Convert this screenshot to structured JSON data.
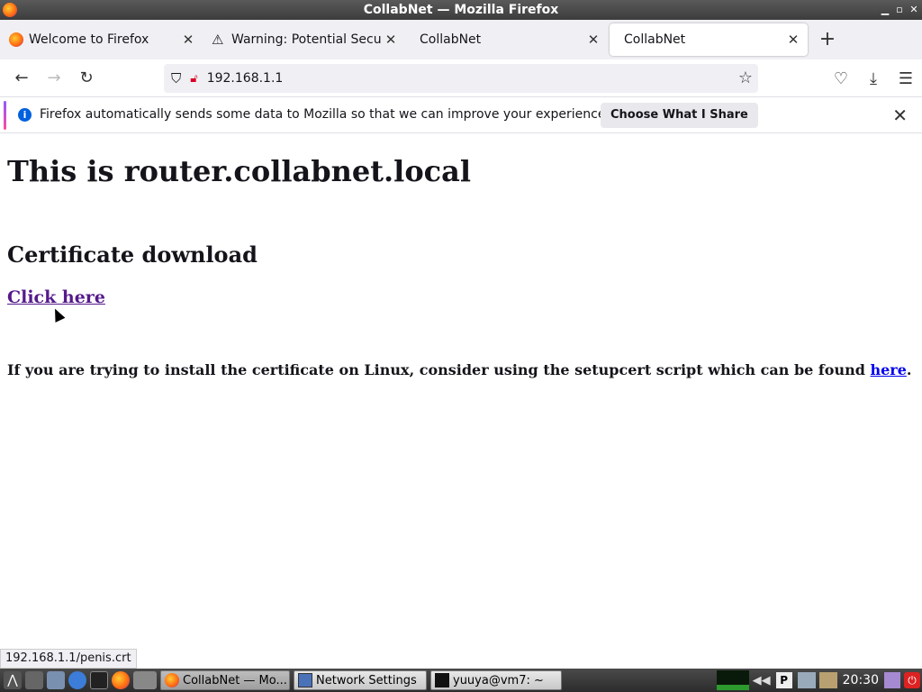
{
  "window": {
    "title": "CollabNet — Mozilla Firefox"
  },
  "tabs": [
    {
      "label": "Welcome to Firefox",
      "icon": "firefox-icon"
    },
    {
      "label": "Warning: Potential Securi",
      "icon": "warning-icon"
    },
    {
      "label": "CollabNet",
      "icon": "none"
    },
    {
      "label": "CollabNet",
      "icon": "none",
      "active": true
    }
  ],
  "navbar": {
    "url": "192.168.1.1"
  },
  "notification": {
    "message": "Firefox automatically sends some data to Mozilla so that we can improve your experience.",
    "button": "Choose What I Share"
  },
  "page": {
    "heading": "This is router.collabnet.local",
    "subheading": "Certificate download",
    "download_link": "Click here",
    "linux_text": "If you are trying to install the certificate on Linux, consider using the setupcert script which can be found ",
    "linux_link": "here",
    "linux_end": "."
  },
  "status_url": "192.168.1.1/penis.crt",
  "taskbar": {
    "tasks": [
      "CollabNet — Mo...",
      "Network Settings",
      "yuuya@vm7: ~"
    ],
    "clock": "20:30"
  },
  "colors": {
    "accent": "#0060df",
    "link_visited": "#551a8b",
    "link": "#0000ee"
  }
}
